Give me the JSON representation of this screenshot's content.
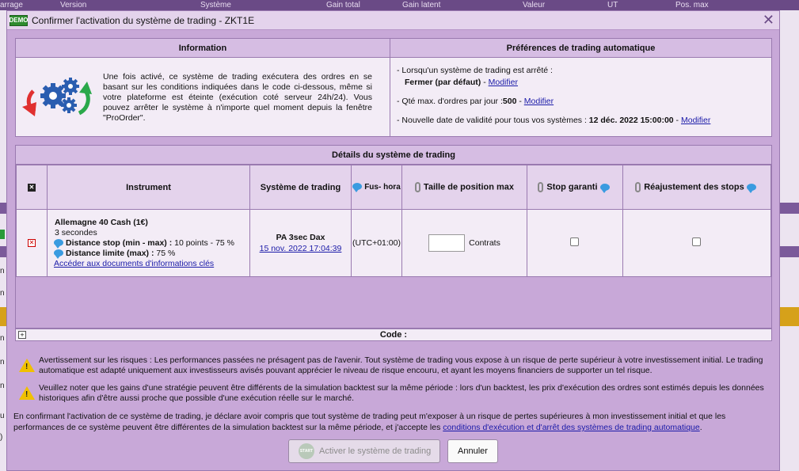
{
  "background": {
    "header_cols": [
      "arrage",
      "Version",
      "Système",
      "Gain total",
      "Gain latent",
      "Valeur",
      "UT",
      "Pos. max"
    ],
    "side_chars": [
      "n",
      "n",
      "n",
      "n",
      "n",
      "u",
      ")"
    ]
  },
  "dialog": {
    "demo_badge": "DEMO",
    "title": "Confirmer l'activation du système de trading - ZKT1E",
    "close_symbol": "✕"
  },
  "info": {
    "heading": "Information",
    "text": "Une fois activé, ce système de trading exécutera des ordres en se basant sur les conditions indiquées dans le code ci-dessous, même si votre plateforme est éteinte (exécution coté serveur 24h/24). Vous pouvez arrêter le système à n'importe quel moment depuis la fenêtre \"ProOrder\"."
  },
  "preferences": {
    "heading": "Préférences de trading automatique",
    "stop_line": "- Lorsqu'un système de trading est arrêté :",
    "stop_value": "Fermer (par défaut)",
    "qty_label": "- Qté max. d'ordres par jour :",
    "qty_value": "500",
    "validity_label": "- Nouvelle date de validité pour tous vos systèmes :",
    "validity_value": "12 déc. 2022 15:00:00",
    "separator": " - ",
    "modify": "Modifier"
  },
  "details": {
    "heading": "Détails du système de trading",
    "columns": {
      "instrument": "Instrument",
      "system": "Système de trading",
      "timezone": "Fus- hora",
      "size": "Taille de position max",
      "guaranteed_stop": "Stop garanti",
      "trailing": "Réajustement des stops"
    },
    "row": {
      "instrument_name": "Allemagne 40 Cash (1€)",
      "interval": "3 secondes",
      "stop_label": "Distance stop (min - max) :",
      "stop_value": "10 points - 75 %",
      "limit_label": "Distance limite (max) :",
      "limit_value": "75 %",
      "docs_link": "Accéder aux documents d'informations clés",
      "system_name": "PA 3sec Dax",
      "system_date": "15 nov. 2022 17:04:39",
      "timezone": "(UTC+01:00)",
      "size_value": "",
      "size_unit": "Contrats",
      "guaranteed_stop_checked": false,
      "trailing_checked": false
    }
  },
  "code_label": "Code :",
  "warnings": [
    "Avertissement sur les risques : Les performances passées ne présagent pas de l'avenir. Tout système de trading vous expose à un risque de perte supérieur à votre investissement initial. Le trading automatique est adapté uniquement aux investisseurs avisés pouvant apprécier le niveau de risque encouru, et ayant les moyens financiers de supporter un tel risque.",
    "Veuillez noter que les gains d'une stratégie peuvent être différents de la simulation backtest sur la même période : lors d'un backtest, les prix d'exécution des ordres sont estimés depuis les données historiques afin d'être aussi proche que possible d'une exécution réelle sur le marché."
  ],
  "confirm": {
    "text": "En confirmant l'activation de ce système de trading, je déclare avoir compris que tout système de trading peut m'exposer à un risque de pertes supérieures à mon investissement initial et que les performances de ce système peuvent être différentes de la simulation backtest sur la même période, et j'accepte les",
    "link": "conditions d'exécution et d'arrêt des systèmes de trading automatique",
    "end": "."
  },
  "buttons": {
    "start_icon": "START",
    "activate": "Activer le système de trading",
    "cancel": "Annuler"
  },
  "colors": {
    "dialog_bg": "#c8a8d8",
    "panel_bg": "#f3ecf6",
    "header_bg": "#d6bde3",
    "link": "#1a1aa8",
    "bubble": "#3a9be0",
    "warning": "#f0c000"
  }
}
